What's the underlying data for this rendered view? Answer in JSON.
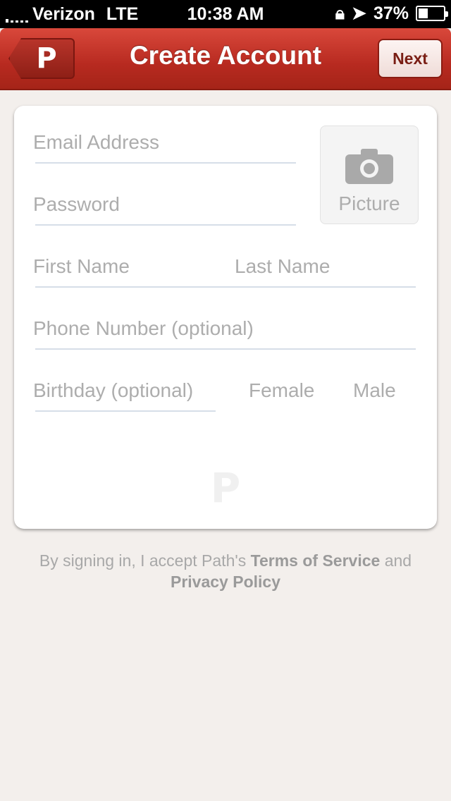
{
  "status_bar": {
    "carrier": "Verizon",
    "network": "LTE",
    "time": "10:38 AM",
    "battery": "37%",
    "battery_fraction": 0.37
  },
  "navbar": {
    "back_icon": "P",
    "title": "Create Account",
    "next_label": "Next"
  },
  "form": {
    "email_placeholder": "Email Address",
    "password_placeholder": "Password",
    "picture_label": "Picture",
    "first_name_placeholder": "First Name",
    "last_name_placeholder": "Last Name",
    "phone_placeholder": "Phone Number (optional)",
    "birthday_placeholder": "Birthday (optional)",
    "gender_female": "Female",
    "gender_male": "Male",
    "watermark": "P"
  },
  "footer": {
    "prefix": "By signing in, I accept Path's ",
    "terms": "Terms of Service",
    "middle": " and",
    "privacy": "Privacy Policy"
  }
}
